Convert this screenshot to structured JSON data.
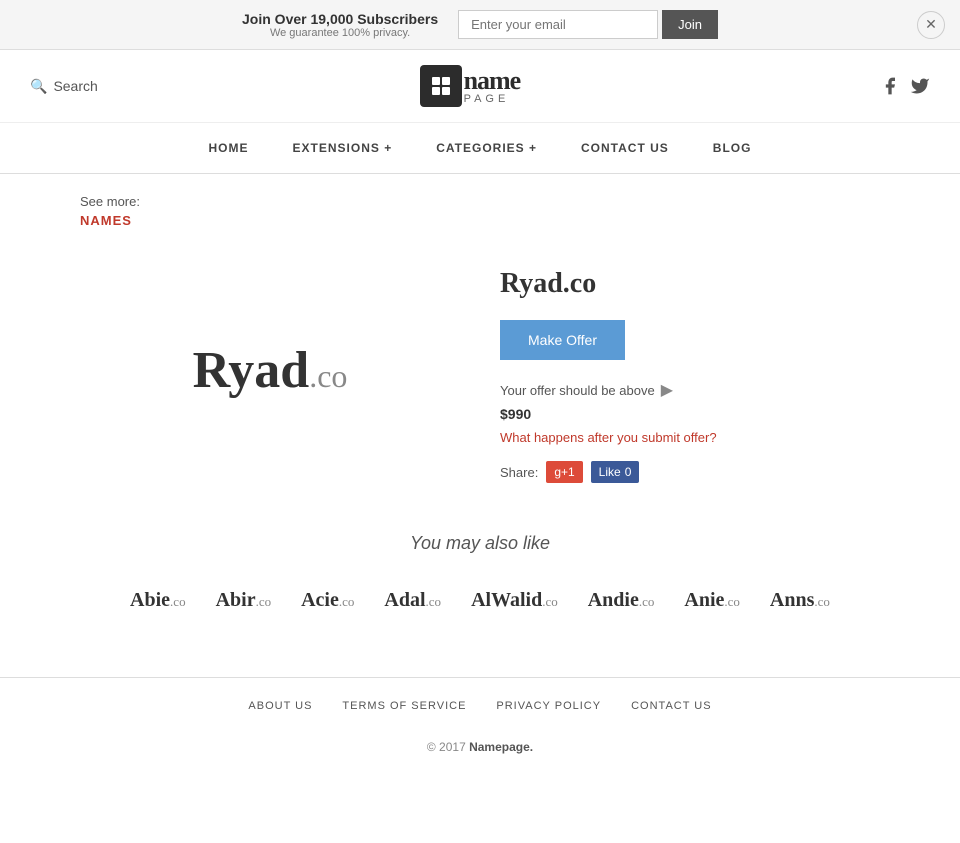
{
  "banner": {
    "headline": "Join Over 19,000 Subscribers",
    "subtext": "We guarantee 100% privacy.",
    "email_placeholder": "Enter your email",
    "join_label": "Join"
  },
  "header": {
    "search_label": "Search",
    "logo_name": "name",
    "logo_page": "PAGE"
  },
  "nav": {
    "items": [
      {
        "label": "HOME",
        "href": "#"
      },
      {
        "label": "EXTENSIONS +",
        "href": "#"
      },
      {
        "label": "CATEGORIES +",
        "href": "#"
      },
      {
        "label": "CONTACT US",
        "href": "#"
      },
      {
        "label": "BLOG",
        "href": "#"
      }
    ]
  },
  "breadcrumb": {
    "see_more": "See more:",
    "link_label": "NAMES"
  },
  "domain": {
    "name": "Ryad",
    "tld": ".co",
    "full": "Ryad.co",
    "make_offer": "Make Offer",
    "offer_note": "Your offer should be above",
    "offer_price": "$990",
    "offer_link": "What happens after you submit offer?",
    "share_label": "Share:",
    "gplus_label": "g+1",
    "fb_label": "Like",
    "fb_count": "0"
  },
  "also_like": {
    "title": "You may also like",
    "items": [
      {
        "name": "Abie",
        "tld": ".co"
      },
      {
        "name": "Abir",
        "tld": ".co"
      },
      {
        "name": "Acie",
        "tld": ".co"
      },
      {
        "name": "Adal",
        "tld": ".co"
      },
      {
        "name": "AlWalid",
        "tld": ".co"
      },
      {
        "name": "Andie",
        "tld": ".co"
      },
      {
        "name": "Anie",
        "tld": ".co"
      },
      {
        "name": "Anns",
        "tld": ".co"
      }
    ]
  },
  "footer": {
    "links": [
      {
        "label": "ABOUT US"
      },
      {
        "label": "TERMS OF SERVICE"
      },
      {
        "label": "PRIVACY POLICY"
      },
      {
        "label": "CONTACT US"
      }
    ],
    "copy": "© 2017",
    "brand": "Namepage."
  }
}
